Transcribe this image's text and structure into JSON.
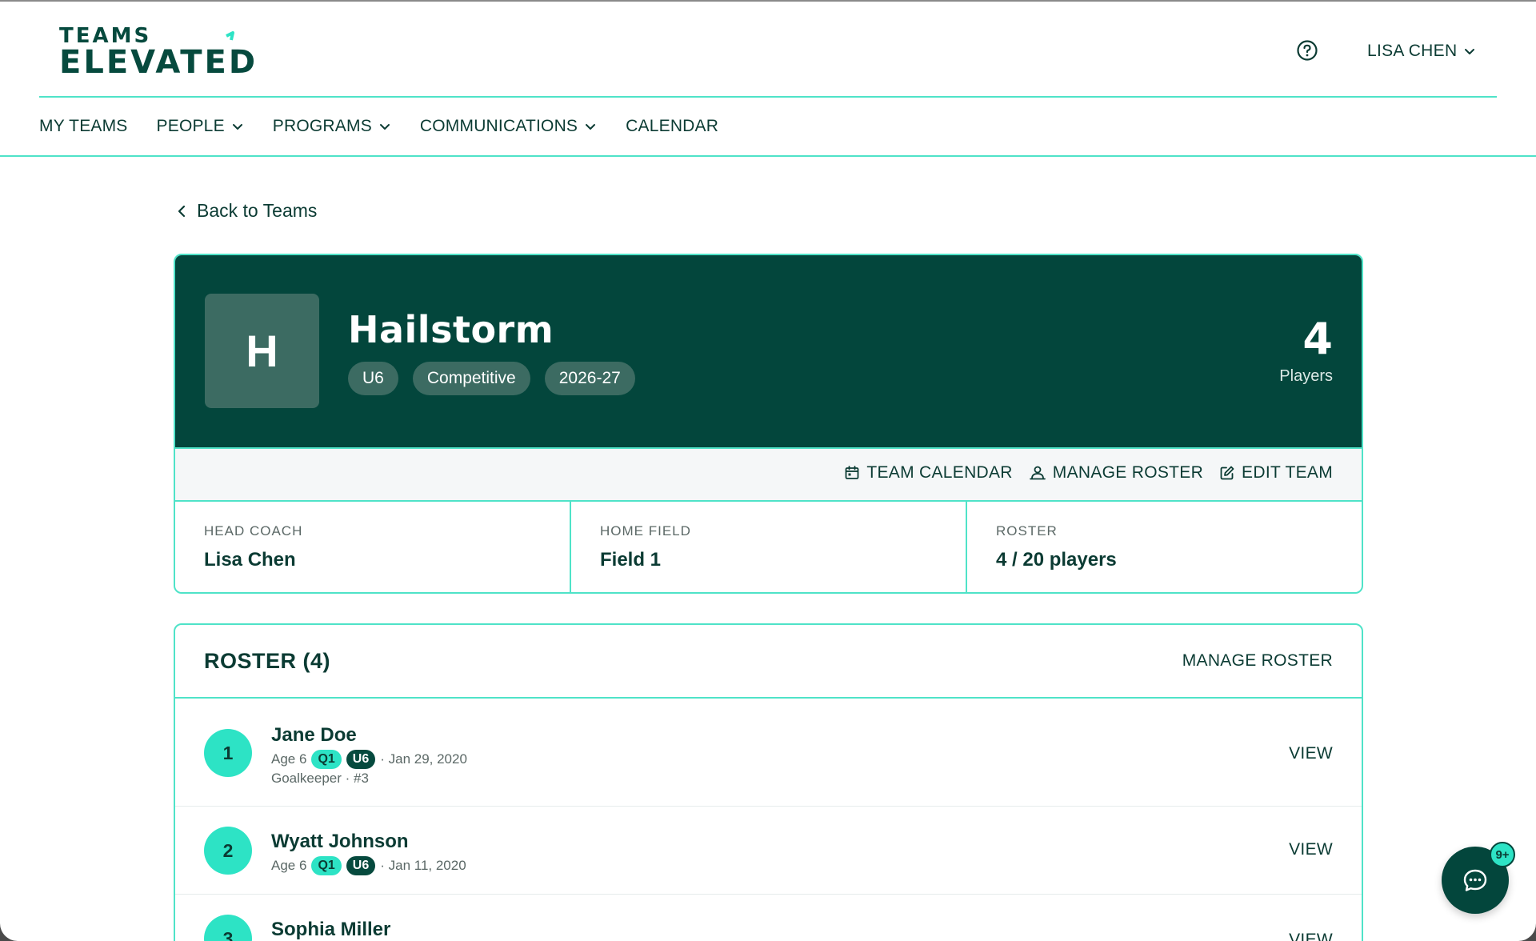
{
  "brand": {
    "line1": "TEAMS",
    "line2": "ELEVATED"
  },
  "user": {
    "name": "LISA CHEN"
  },
  "nav": {
    "items": [
      {
        "label": "MY TEAMS"
      },
      {
        "label": "PEOPLE"
      },
      {
        "label": "PROGRAMS"
      },
      {
        "label": "COMMUNICATIONS"
      },
      {
        "label": "CALENDAR"
      }
    ]
  },
  "back": {
    "label": "Back to Teams"
  },
  "team": {
    "initial": "H",
    "name": "Hailstorm",
    "tags": [
      "U6",
      "Competitive",
      "2026-27"
    ],
    "players_count": "4",
    "players_label": "Players",
    "actions": {
      "calendar": "TEAM CALENDAR",
      "manage_roster": "MANAGE ROSTER",
      "edit": "EDIT TEAM"
    },
    "info": {
      "coach_label": "HEAD COACH",
      "coach_value": "Lisa Chen",
      "field_label": "HOME FIELD",
      "field_value": "Field 1",
      "roster_label": "ROSTER",
      "roster_value": "4 / 20 players"
    }
  },
  "roster": {
    "title": "ROSTER (4)",
    "manage_label": "MANAGE ROSTER",
    "view_label": "VIEW",
    "players": [
      {
        "num": "1",
        "name": "Jane Doe",
        "age": "Age 6",
        "quarter": "Q1",
        "group": "U6",
        "dob": "· Jan 29, 2020",
        "position": "Goalkeeper · #3"
      },
      {
        "num": "2",
        "name": "Wyatt Johnson",
        "age": "Age 6",
        "quarter": "Q1",
        "group": "U6",
        "dob": "· Jan 11, 2020"
      },
      {
        "num": "3",
        "name": "Sophia Miller"
      }
    ]
  },
  "chat": {
    "badge": "9+"
  },
  "colors": {
    "primary": "#03463c",
    "accent": "#2de3c5",
    "border": "#4fe3c8"
  }
}
